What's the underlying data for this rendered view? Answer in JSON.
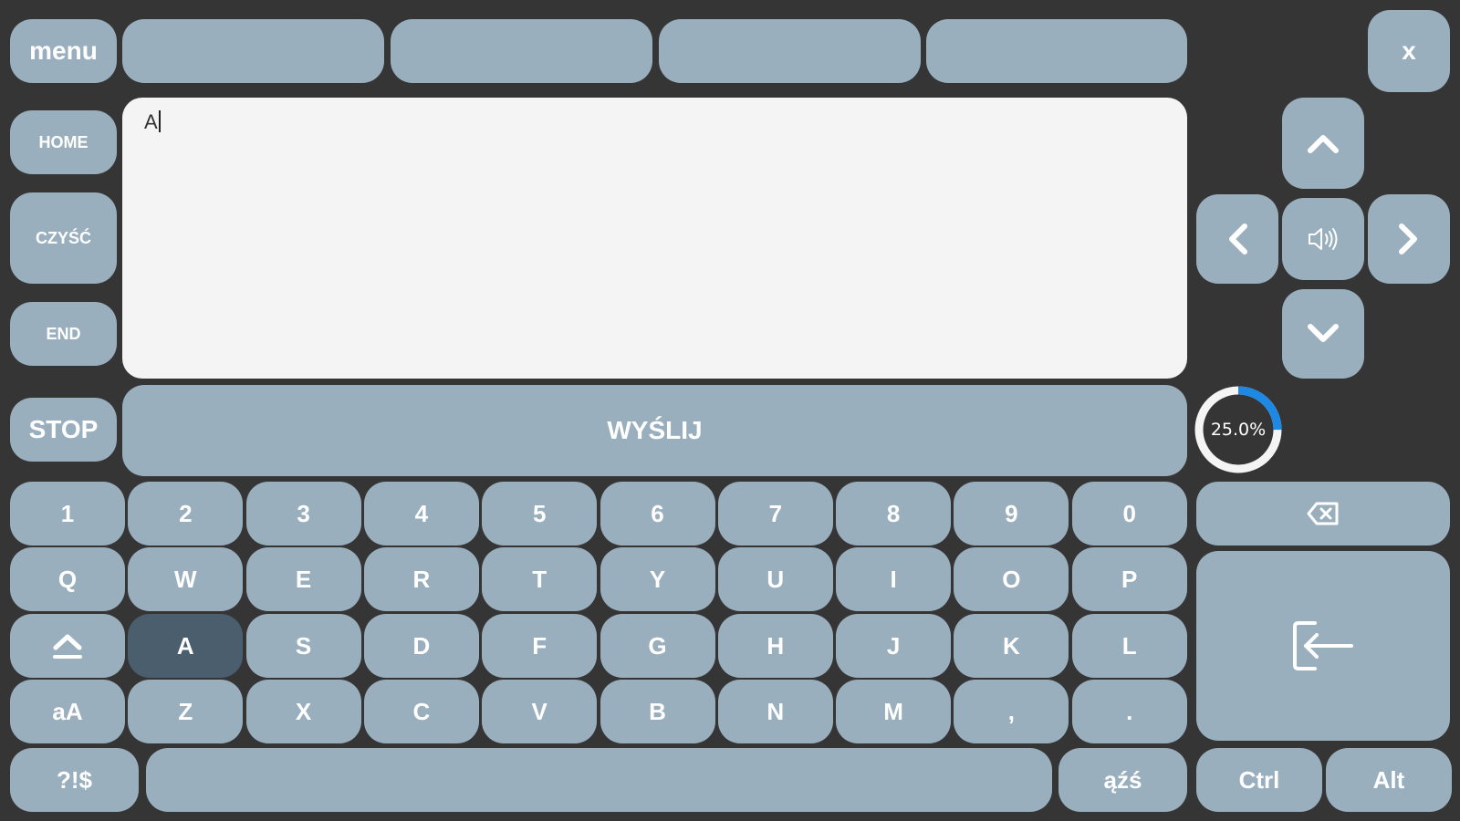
{
  "top": {
    "menu_label": "menu",
    "close_label": "x",
    "suggestions": [
      "",
      "",
      "",
      ""
    ]
  },
  "side": {
    "home_label": "HOME",
    "clear_label": "CZYŚĆ",
    "end_label": "END",
    "stop_label": "STOP"
  },
  "editor": {
    "text": "A"
  },
  "send_label": "WYŚLIJ",
  "progress": {
    "value": 0.25,
    "label": "25.0%",
    "track_color": "#f4f4f4",
    "fill_color": "#1e88e5"
  },
  "nav": {
    "up_icon": "chevron-up-icon",
    "down_icon": "chevron-down-icon",
    "left_icon": "chevron-left-icon",
    "right_icon": "chevron-right-icon",
    "speak_icon": "speaker-icon"
  },
  "keyboard": {
    "row1": [
      "1",
      "2",
      "3",
      "4",
      "5",
      "6",
      "7",
      "8",
      "9",
      "0"
    ],
    "row2": [
      "Q",
      "W",
      "E",
      "R",
      "T",
      "Y",
      "U",
      "I",
      "O",
      "P"
    ],
    "row3": [
      "A",
      "S",
      "D",
      "F",
      "G",
      "H",
      "J",
      "K",
      "L"
    ],
    "row4": [
      "Z",
      "X",
      "C",
      "V",
      "B",
      "N",
      "M",
      ",",
      "."
    ],
    "highlighted_key": "A",
    "case_label": "aA",
    "symbols_label": "?!$",
    "diacritics_label": "ąźś",
    "space_label": "",
    "ctrl_label": "Ctrl",
    "alt_label": "Alt",
    "backspace_icon": "backspace-icon",
    "enter_icon": "enter-icon",
    "shift_icon": "shift-icon"
  },
  "colors": {
    "background": "#353535",
    "key": "#9aafbe",
    "key_active": "#4a5e6e",
    "text_area": "#f4f4f4"
  }
}
